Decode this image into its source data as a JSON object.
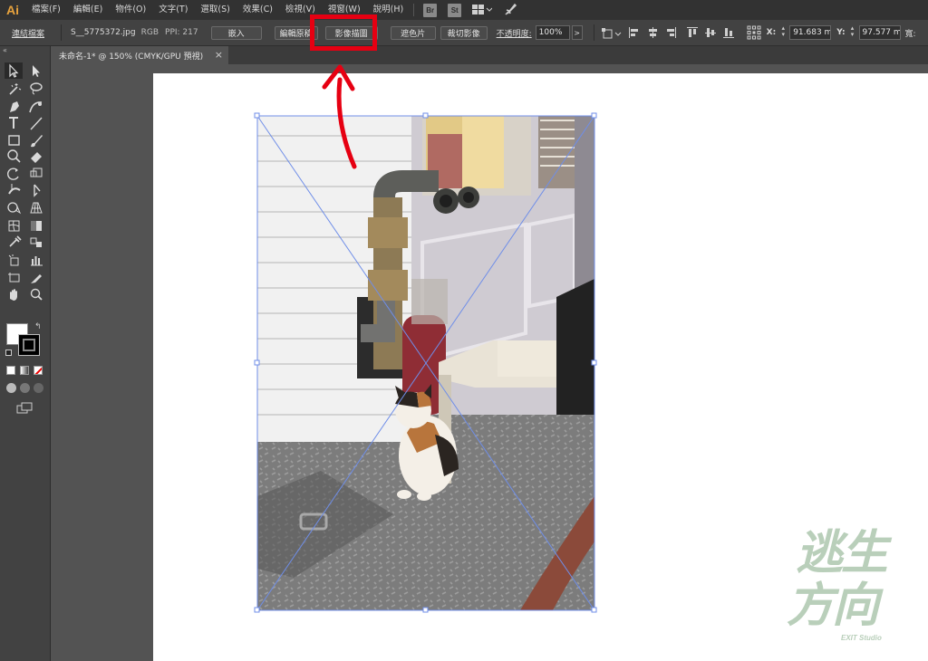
{
  "app": {
    "logo": "Ai"
  },
  "menu": [
    "檔案(F)",
    "編輯(E)",
    "物件(O)",
    "文字(T)",
    "選取(S)",
    "效果(C)",
    "檢視(V)",
    "視窗(W)",
    "說明(H)"
  ],
  "bridge": {
    "br": "Br",
    "st": "St"
  },
  "control_bar": {
    "linked_file": "連結檔案",
    "filename": "S__5775372.jpg",
    "color_mode": "RGB",
    "ppi": "PPI: 217",
    "embed": "嵌入",
    "edit_original": "編輯原稿",
    "image_trace": "影像描圖",
    "mask": "遮色片",
    "crop": "裁切影像",
    "opacity_label": "不透明度:",
    "opacity_value": "100%",
    "x_label": "X:",
    "x_value": "91.683 m",
    "y_label": "Y:",
    "y_value": "97.577 m",
    "w_label": "寬:"
  },
  "document_tab": {
    "title": "未命名-1* @ 150% (CMYK/GPU 預視)",
    "close": "×"
  },
  "watermark": {
    "line1": "逃生",
    "line2": "方向",
    "sub": "EXIT Studio"
  },
  "colors": {
    "highlight": "#e60012",
    "selection": "#6f8ee8",
    "arrow": "#e60012"
  },
  "tools": [
    "selection-tool",
    "direct-selection-tool",
    "magic-wand-tool",
    "lasso-tool",
    "pen-tool",
    "curvature-tool",
    "type-tool",
    "line-tool",
    "rectangle-tool",
    "paintbrush-tool",
    "shaper-tool",
    "eraser-tool",
    "rotate-tool",
    "scale-tool",
    "width-tool",
    "free-transform-tool",
    "shape-builder-tool",
    "perspective-grid-tool",
    "mesh-tool",
    "gradient-tool",
    "eyedropper-tool",
    "blend-tool",
    "symbol-sprayer-tool",
    "column-graph-tool",
    "artboard-tool",
    "slice-tool",
    "hand-tool",
    "zoom-tool"
  ]
}
